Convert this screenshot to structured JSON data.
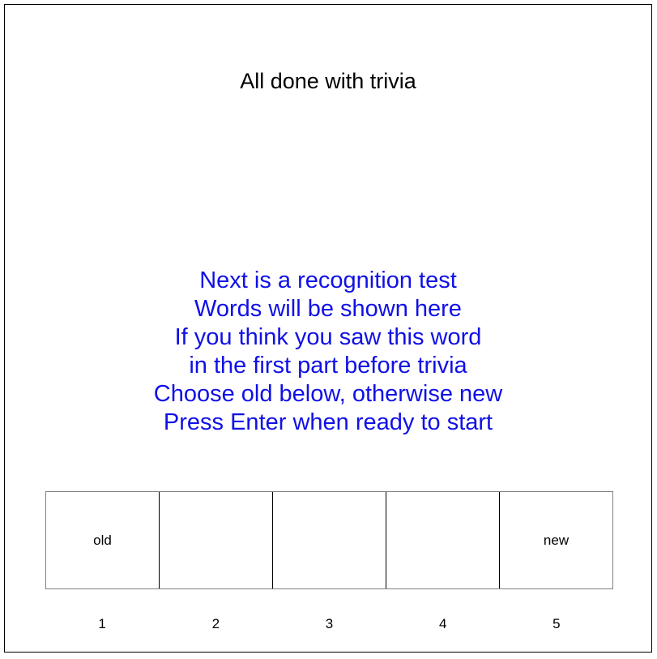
{
  "title": "All done with trivia",
  "instructions": {
    "color": "#1010e6",
    "lines": [
      "Next is a recognition test",
      "Words will be shown here",
      "If you think you saw this word",
      "in the first part before trivia",
      "Choose old below, otherwise new",
      "Press Enter when ready to start"
    ]
  },
  "scale": {
    "boxes": [
      "old",
      "",
      "",
      "",
      "new"
    ],
    "numbers": [
      "1",
      "2",
      "3",
      "4",
      "5"
    ]
  }
}
